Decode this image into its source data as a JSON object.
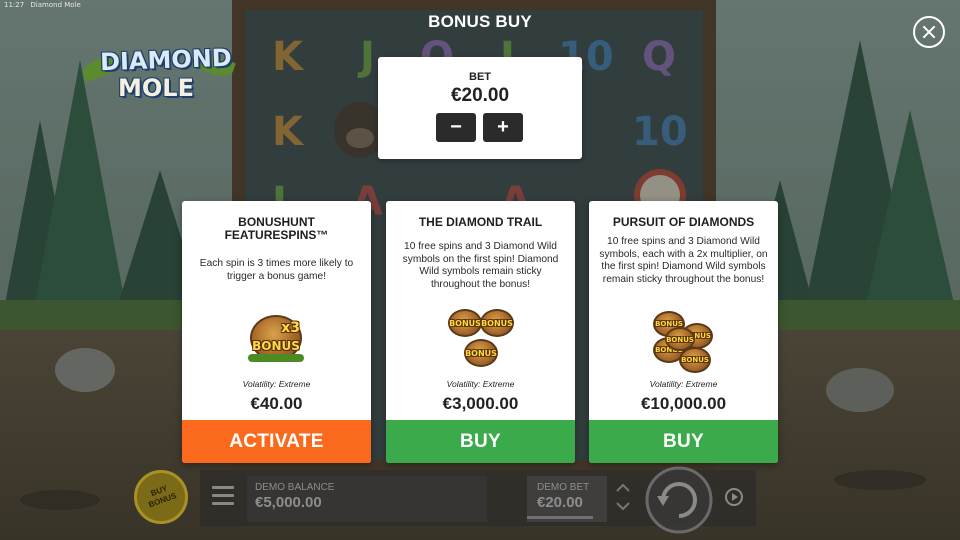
{
  "status_bar": {
    "time": "11:27",
    "app_name": "Diamond Mole"
  },
  "logo": {
    "line1": "DIAMOND",
    "line2": "MOLE"
  },
  "background": {
    "reel_symbols": [
      "K",
      "J",
      "Q",
      "J",
      "10",
      "Q",
      "K",
      "10",
      "J",
      "A",
      "A"
    ]
  },
  "header": {
    "title": "BONUS BUY",
    "close_icon": "close-icon"
  },
  "bet_panel": {
    "label": "BET",
    "value": "€20.00",
    "decrease_label": "−",
    "increase_label": "+"
  },
  "cards": [
    {
      "title_line1": "BONUSHUNT",
      "title_line2": "FEATURESPINS™",
      "description": "Each spin is 3 times more likely to trigger a bonus game!",
      "art_text_top": "x3",
      "art_text_bottom": "BONUS",
      "volatility": "Volatility: Extreme",
      "price": "€40.00",
      "button_label": "ACTIVATE",
      "button_color": "#fb6a1c"
    },
    {
      "title_line1": "THE DIAMOND TRAIL",
      "title_line2": "",
      "description": "10 free spins and 3 Diamond Wild symbols on the first spin! Diamond Wild symbols remain sticky throughout the bonus!",
      "art_text": "BONUS",
      "art_badge_count": 3,
      "volatility": "Volatility: Extreme",
      "price": "€3,000.00",
      "button_label": "BUY",
      "button_color": "#3aaa4a"
    },
    {
      "title_line1": "PURSUIT OF DIAMONDS",
      "title_line2": "",
      "description": "10 free spins and 3 Diamond Wild symbols, each with a 2x multiplier, on the first spin! Diamond Wild symbols remain sticky throughout the bonus!",
      "art_text": "BONUS",
      "art_badge_count": 5,
      "volatility": "Volatility: Extreme",
      "price": "€10,000.00",
      "button_label": "BUY",
      "button_color": "#3aaa4a"
    }
  ],
  "bottom_bar": {
    "buy_bonus_label_line1": "BUY",
    "buy_bonus_label_line2": "BONUS",
    "balance_label": "DEMO BALANCE",
    "balance_value": "€5,000.00",
    "bet_label": "DEMO BET",
    "bet_value": "€20.00",
    "menu_icon": "hamburger-menu-icon",
    "spin_icon": "spin-arrow-icon",
    "autoplay_icon": "autoplay-icon"
  },
  "colors": {
    "activate": "#fb6a1c",
    "buy": "#3aaa4a",
    "panel_bg": "#ffffff",
    "stepper_bg": "#2b2b2b"
  }
}
